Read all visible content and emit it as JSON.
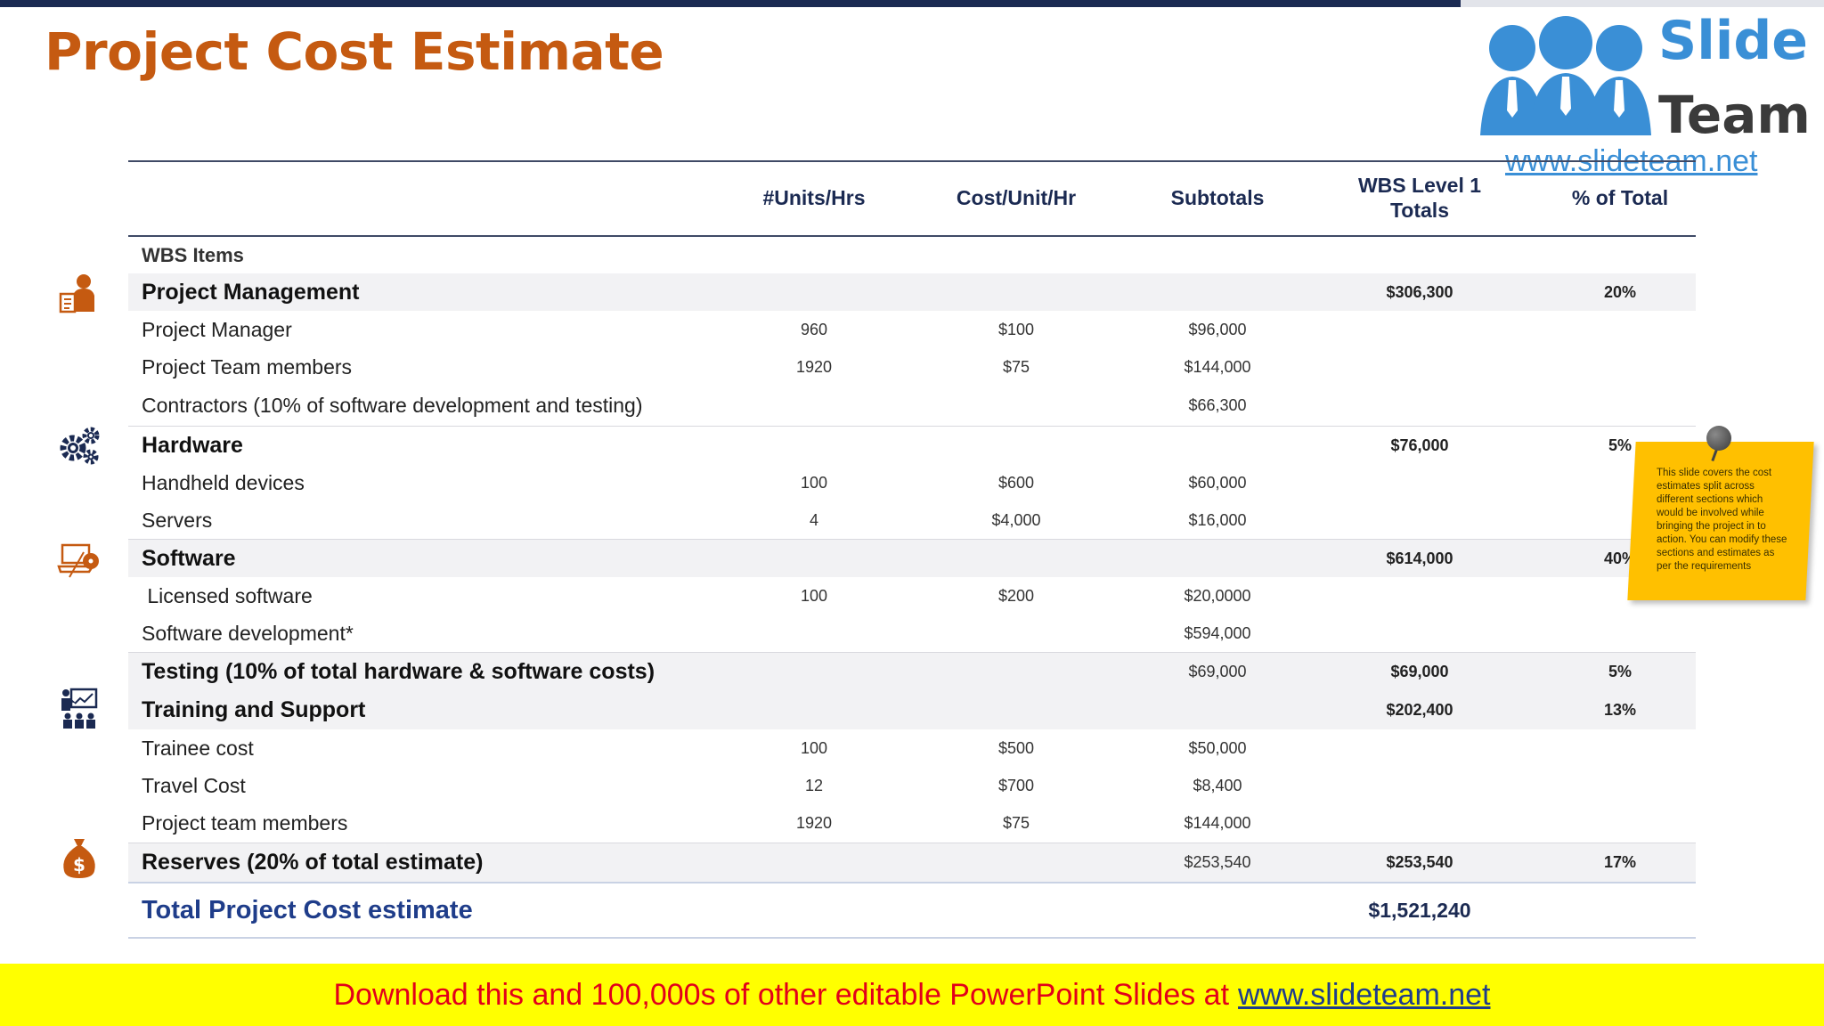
{
  "slide": {
    "title": "Project Cost Estimate"
  },
  "logo": {
    "word1": "Slide",
    "word2": "Team",
    "url": "www.slideteam.net"
  },
  "table": {
    "headers": {
      "units": "#Units/Hrs",
      "cost": "Cost/Unit/Hr",
      "subtotals": "Subtotals",
      "wbs_line1": "WBS Level 1",
      "wbs_line2": "Totals",
      "pct": "% of Total"
    },
    "wbs_items_label": "WBS Items",
    "rows": [
      {
        "item": "Project Management",
        "wbs": "$306,300",
        "pct": "20%"
      },
      {
        "item": "Project Manager",
        "units": "960",
        "cost": "$100",
        "subtotal": "$96,000"
      },
      {
        "item": "Project Team members",
        "units": "1920",
        "cost": "$75",
        "subtotal": "$144,000"
      },
      {
        "item": "Contractors (10% of software development and testing)",
        "subtotal": "$66,300"
      },
      {
        "item": "Hardware",
        "wbs": "$76,000",
        "pct": "5%"
      },
      {
        "item": "Handheld devices",
        "units": "100",
        "cost": "$600",
        "subtotal": "$60,000"
      },
      {
        "item": "Servers",
        "units": "4",
        "cost": "$4,000",
        "subtotal": "$16,000"
      },
      {
        "item": "Software",
        "wbs": "$614,000",
        "pct": "40%"
      },
      {
        "item": " Licensed software",
        "units": "100",
        "cost": "$200",
        "subtotal": "$20,0000"
      },
      {
        "item": "Software development*",
        "subtotal": "$594,000"
      },
      {
        "item": "Testing (10% of total hardware & software costs)",
        "subtotal": "$69,000",
        "wbs": "$69,000",
        "pct": "5%"
      },
      {
        "item": "Training and Support",
        "wbs": "$202,400",
        "pct": "13%"
      },
      {
        "item": "Trainee cost",
        "units": "100",
        "cost": "$500",
        "subtotal": "$50,000"
      },
      {
        "item": "Travel Cost",
        "units": "12",
        "cost": "$700",
        "subtotal": "$8,400"
      },
      {
        "item": "Project team members",
        "units": "1920",
        "cost": "$75",
        "subtotal": "$144,000"
      },
      {
        "item": "Reserves (20% of total estimate)",
        "subtotal": "$253,540",
        "wbs": "$253,540",
        "pct": "17%"
      }
    ],
    "total": {
      "label": "Total Project Cost estimate",
      "value": "$1,521,240"
    }
  },
  "category_icons": [
    "project-management-icon",
    "hardware-gears-icon",
    "software-laptop-icon",
    "training-presentation-icon",
    "reserves-money-bag-icon"
  ],
  "note": {
    "text": "This slide covers the cost estimates split across different sections which would be involved while bringing the project in to action. You can modify these sections and estimates as per the requirements"
  },
  "footer": {
    "text": "Download this and 100,000s of other editable PowerPoint Slides at",
    "url": "www.slideteam.net"
  },
  "colors": {
    "title": "#c55a11",
    "header_text": "#1b2a52",
    "total_text": "#1f3d8a",
    "note": "#ffc000",
    "footer_bg": "#ffff00",
    "footer_text": "#e2001a"
  }
}
